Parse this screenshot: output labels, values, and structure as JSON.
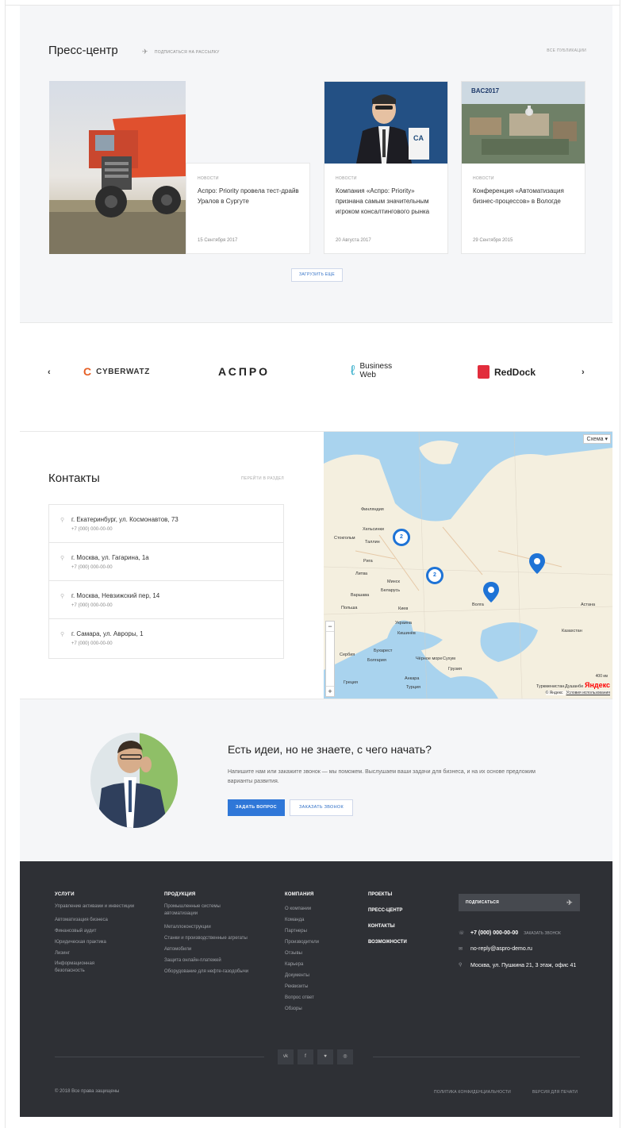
{
  "press": {
    "title": "Пресс-центр",
    "subscribe": "Подписаться на рассылку",
    "all": "Все публикации",
    "load_more": "Загрузить еще",
    "items": [
      {
        "category": "Новости",
        "title": "Аспро: Priority провела тест-драйв Уралов в Сургуте",
        "date": "15 Сентября 2017"
      },
      {
        "category": "Новости",
        "title": "Компания «Аспро: Priority» признана самым значительным игроком консалтингового рынка",
        "date": "20 Августа 2017"
      },
      {
        "category": "Новости",
        "title": "Конференция «Автоматизация бизнес-процессов» в Вологде",
        "date": "29 Сентября 2015"
      }
    ],
    "image_text": {
      "bac": "BAC2017",
      "ca": "CA"
    }
  },
  "partners": {
    "prev": "‹",
    "next": "›",
    "logos": [
      "CYBERWATZ",
      "АСПРО",
      "Business Web",
      "RedDock"
    ]
  },
  "contacts": {
    "title": "Контакты",
    "goto": "Перейти в раздел",
    "items": [
      {
        "address": "г. Екатеринбург, ул. Космонавтов, 73",
        "phone": "+7 (000) 000-00-00"
      },
      {
        "address": "г. Москва, ул. Гагарина, 1а",
        "phone": "+7 (000) 000-00-00"
      },
      {
        "address": "г. Москва, Невзижский пер, 14",
        "phone": "+7 (000) 000-00-00"
      },
      {
        "address": "г. Самара, ул. Авроры, 1",
        "phone": "+7 (000) 000-00-00"
      }
    ]
  },
  "map": {
    "scheme": "Схема ▾",
    "yandex": "Яндекс",
    "scale": "400 км",
    "copyright": "© Яндекс",
    "terms": "Условия использования",
    "clusters": [
      "2",
      "2"
    ],
    "labels": [
      "Финляндия",
      "Хельсинки",
      "Стокгольм",
      "Таллин",
      "Рига",
      "Минск",
      "Беларусь",
      "Варшава",
      "Польша",
      "Киев",
      "Украина",
      "Кишинёв",
      "Бухарест",
      "Болгария",
      "Сербия",
      "Греция",
      "Турция",
      "Анкара",
      "Чёрное море",
      "Сухум",
      "Грузия",
      "Казахстан",
      "Астана",
      "Туркменистан",
      "Душанбе",
      "Литва",
      "Волга"
    ]
  },
  "cta": {
    "title": "Есть идеи, но не знаете, с чего начать?",
    "text": "Напишите нам или закажите звонок — мы поможем. Выслушаем ваши задачи для бизнеса, и на их основе предложим варианты развития.",
    "ask": "Задать вопрос",
    "call": "Заказать звонок"
  },
  "footer": {
    "services": {
      "title": "Услуги",
      "items": [
        "Управление активами и инвестиции",
        "Автоматизация бизнеса",
        "Финансовый аудит",
        "Юридическая практика",
        "Лизинг",
        "Информационная безопасность"
      ]
    },
    "products": {
      "title": "Продукция",
      "items": [
        "Промышленные системы автоматизации",
        "Металлоконструкции",
        "Станки и производственные агрегаты",
        "Автомобили",
        "Защита онлайн-платежей",
        "Оборудование для нефте-газодобычи"
      ]
    },
    "company": {
      "title": "Компания",
      "items": [
        "О компании",
        "Команда",
        "Партнеры",
        "Производители",
        "Отзывы",
        "Карьера",
        "Документы",
        "Реквизиты",
        "Вопрос ответ",
        "Обзоры"
      ]
    },
    "nav": [
      "Проекты",
      "Пресс-центр",
      "Контакты",
      "Возможности"
    ],
    "subscribe": "Подписаться",
    "phone": "+7 (000) 000-00-00",
    "call_link": "Заказать звонок",
    "email": "no-reply@aspro-demo.ru",
    "address": "Москва, ул. Пушкина 21, 3 этаж, офис 41",
    "social": [
      "vk",
      "f",
      "tw",
      "ig"
    ],
    "copyright": "© 2018 Все права защищены",
    "privacy": "Политика конфиденциальности",
    "print": "Версия для печати"
  }
}
